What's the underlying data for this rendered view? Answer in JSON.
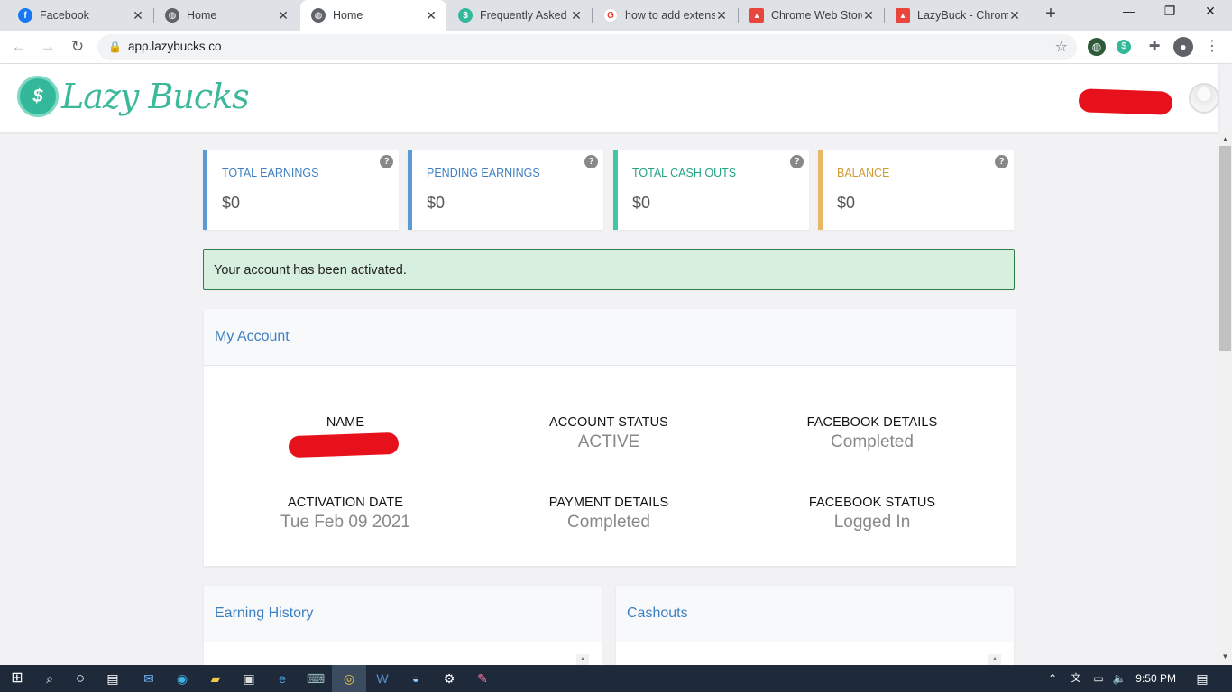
{
  "browser": {
    "tabs": [
      {
        "title": "Facebook",
        "favicon": "facebook-icon",
        "color": "#1877f2",
        "active": false
      },
      {
        "title": "Home",
        "favicon": "globe-icon",
        "color": "#5f6368",
        "active": false
      },
      {
        "title": "Home",
        "favicon": "globe-icon",
        "color": "#5f6368",
        "active": true
      },
      {
        "title": "Frequently Asked",
        "favicon": "lazybucks-icon",
        "color": "#33b99a",
        "active": false
      },
      {
        "title": "how to add extens",
        "favicon": "google-icon",
        "color": "#ea4335",
        "active": false
      },
      {
        "title": "Chrome Web Store",
        "favicon": "webstore-icon",
        "color": "#e8453c",
        "active": false
      },
      {
        "title": "LazyBuck - Chrom",
        "favicon": "webstore-icon",
        "color": "#e8453c",
        "active": false
      }
    ],
    "url": "app.lazybucks.co"
  },
  "site": {
    "logo_text": "Lazy Bucks"
  },
  "stats": [
    {
      "label": "TOTAL EARNINGS",
      "value": "$0",
      "color": "#5b9bd5"
    },
    {
      "label": "PENDING EARNINGS",
      "value": "$0",
      "color": "#5b9bd5"
    },
    {
      "label": "TOTAL CASH OUTS",
      "value": "$0",
      "color": "#3cc9a4"
    },
    {
      "label": "BALANCE",
      "value": "$0",
      "color": "#e8b86a"
    }
  ],
  "alert": "Your account has been activated.",
  "account": {
    "title": "My Account",
    "fields": [
      {
        "label": "NAME",
        "value": ""
      },
      {
        "label": "ACCOUNT STATUS",
        "value": "ACTIVE"
      },
      {
        "label": "FACEBOOK DETAILS",
        "value": "Completed"
      },
      {
        "label": "ACTIVATION DATE",
        "value": "Tue Feb 09 2021"
      },
      {
        "label": "PAYMENT DETAILS",
        "value": "Completed"
      },
      {
        "label": "FACEBOOK STATUS",
        "value": "Logged In"
      }
    ]
  },
  "earning_history": {
    "title": "Earning History"
  },
  "cashouts": {
    "title": "Cashouts"
  },
  "taskbar": {
    "time": "9:50 PM"
  }
}
